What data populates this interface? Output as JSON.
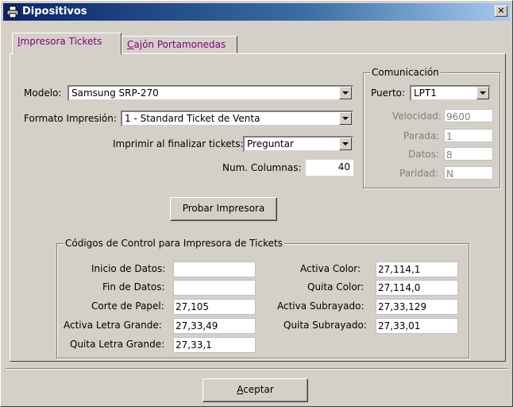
{
  "window": {
    "title": "Dipositivos"
  },
  "tabs": [
    {
      "underline": "I",
      "rest": "mpresora Tickets"
    },
    {
      "underline": "C",
      "rest": "ajón Portamonedas"
    }
  ],
  "printer": {
    "modelo_label": "Modelo:",
    "modelo_value": "Samsung SRP-270",
    "formato_label": "Formato Impresión:",
    "formato_value": "1 - Standard Ticket de Venta",
    "imprimir_label": "Imprimir al finalizar tickets:",
    "imprimir_value": "Preguntar",
    "columnas_label": "Num. Columnas:",
    "columnas_value": "40",
    "test_button": "Probar Impresora"
  },
  "comunicacion": {
    "title": "Comunicación",
    "puerto_label": "Puerto:",
    "puerto_value": "LPT1",
    "velocidad_label": "Velocidad:",
    "velocidad_value": "9600",
    "parada_label": "Parada:",
    "parada_value": "1",
    "datos_label": "Datos:",
    "datos_value": "8",
    "paridad_label": "Paridad:",
    "paridad_value": "N"
  },
  "codes": {
    "title": "Códigos de Control para Impresora de Tickets",
    "inicio_label": "Inicio de Datos:",
    "inicio_value": "",
    "fin_label": "Fin de Datos:",
    "fin_value": "",
    "corte_label": "Corte de Papel:",
    "corte_value": "27,105",
    "activa_grande_label": "Activa Letra Grande:",
    "activa_grande_value": "27,33,49",
    "quita_grande_label": "Quita Letra Grande:",
    "quita_grande_value": "27,33,1",
    "activa_color_label": "Activa Color:",
    "activa_color_value": "27,114,1",
    "quita_color_label": "Quita Color:",
    "quita_color_value": "27,114,0",
    "activa_sub_label": "Activa Subrayado:",
    "activa_sub_value": "27,33,129",
    "quita_sub_label": "Quita Subrayado:",
    "quita_sub_value": "27,33,01"
  },
  "footer": {
    "ok_underline": "A",
    "ok_rest": "ceptar"
  },
  "icons": {
    "title": "printer-icon",
    "close": "close-icon"
  }
}
